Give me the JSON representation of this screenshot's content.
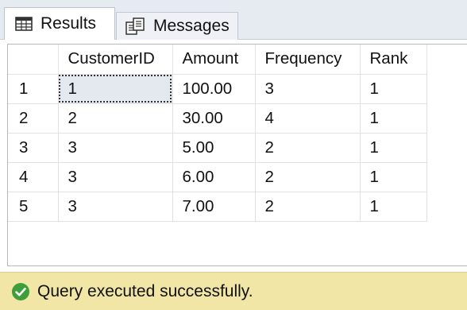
{
  "tabs": [
    {
      "label": "Results",
      "icon": "grid-results-icon",
      "active": true
    },
    {
      "label": "Messages",
      "icon": "messages-icon",
      "active": false
    }
  ],
  "grid": {
    "columns": [
      "",
      "CustomerID",
      "Amount",
      "Frequency",
      "Rank"
    ],
    "rows": [
      {
        "num": "1",
        "CustomerID": "1",
        "Amount": "100.00",
        "Frequency": "3",
        "Rank": "1"
      },
      {
        "num": "2",
        "CustomerID": "2",
        "Amount": "30.00",
        "Frequency": "4",
        "Rank": "1"
      },
      {
        "num": "3",
        "CustomerID": "3",
        "Amount": "5.00",
        "Frequency": "2",
        "Rank": "1"
      },
      {
        "num": "4",
        "CustomerID": "3",
        "Amount": "6.00",
        "Frequency": "2",
        "Rank": "1"
      },
      {
        "num": "5",
        "CustomerID": "3",
        "Amount": "7.00",
        "Frequency": "2",
        "Rank": "1"
      }
    ]
  },
  "status": {
    "text": "Query executed successfully.",
    "icon": "check-circle-icon",
    "icon_color": "#3e9e3a",
    "bar_color": "#f1e6a5"
  }
}
